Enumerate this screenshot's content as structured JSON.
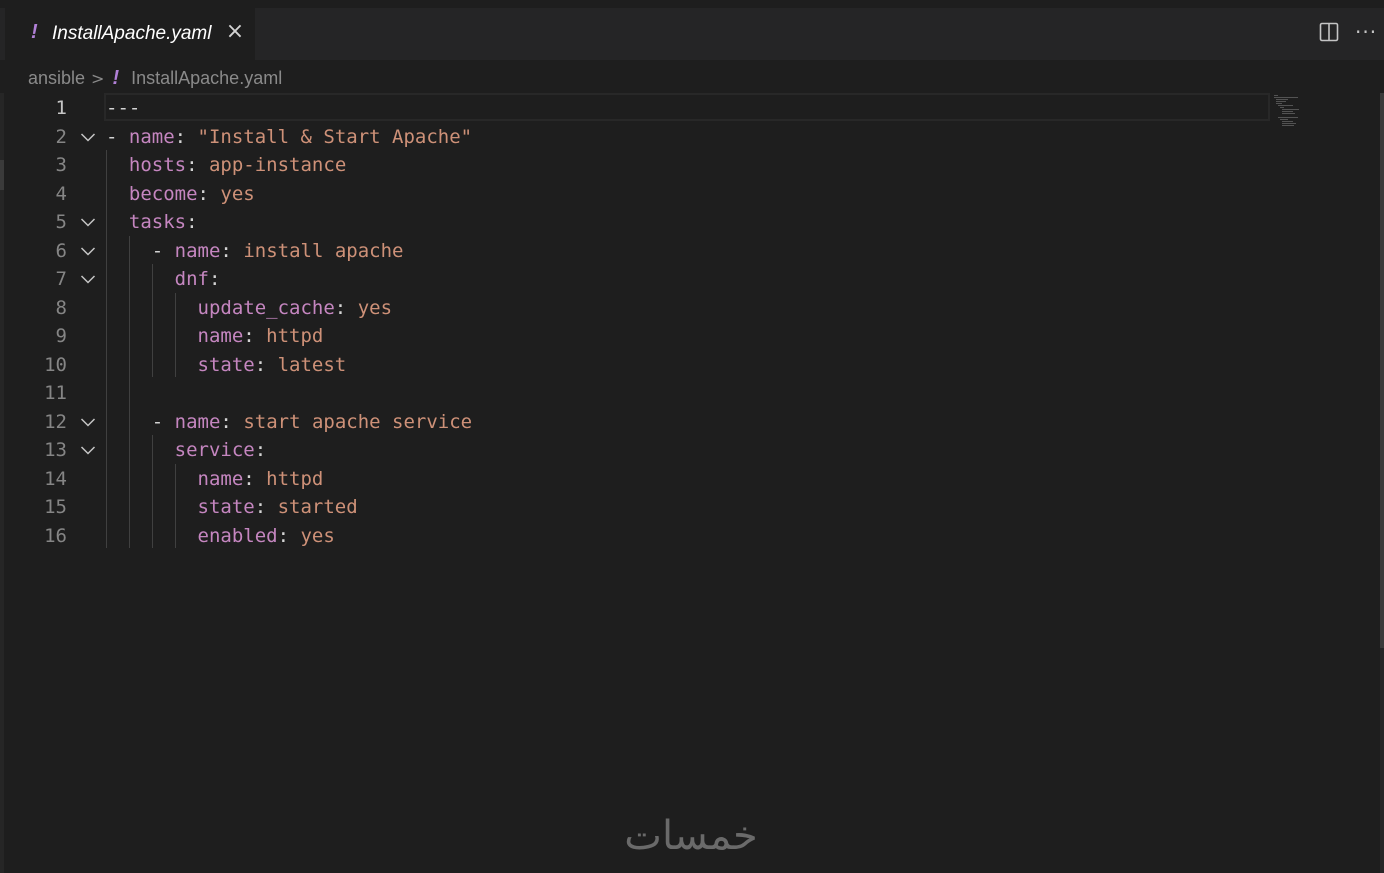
{
  "tab": {
    "icon": "!",
    "title": "InstallApache.yaml",
    "close_glyph": "×"
  },
  "toolbar": {
    "split_icon": "split-editor-icon",
    "more_icon": "more-actions-icon",
    "more_glyph": "···"
  },
  "breadcrumb": {
    "folder": "ansible",
    "separator": ">",
    "file_icon": "!",
    "file": "InstallApache.yaml"
  },
  "editor": {
    "language": "yaml",
    "active_line": 1,
    "colors": {
      "key": "#c586c0",
      "value": "#ce9178",
      "punctuation": "#d4d4d4",
      "line_number": "#858585",
      "background": "#1e1e1e"
    },
    "lines": [
      {
        "n": "1",
        "fold": false,
        "indent": "",
        "tokens": [
          {
            "t": "p",
            "s": "---"
          }
        ]
      },
      {
        "n": "2",
        "fold": true,
        "indent": "",
        "tokens": [
          {
            "t": "p",
            "s": "- "
          },
          {
            "t": "k",
            "s": "name"
          },
          {
            "t": "p",
            "s": ": "
          },
          {
            "t": "v",
            "s": "\"Install & Start Apache\""
          }
        ]
      },
      {
        "n": "3",
        "fold": false,
        "indent": "  ",
        "tokens": [
          {
            "t": "k",
            "s": "hosts"
          },
          {
            "t": "p",
            "s": ": "
          },
          {
            "t": "v",
            "s": "app-instance"
          }
        ]
      },
      {
        "n": "4",
        "fold": false,
        "indent": "  ",
        "tokens": [
          {
            "t": "k",
            "s": "become"
          },
          {
            "t": "p",
            "s": ": "
          },
          {
            "t": "v",
            "s": "yes"
          }
        ]
      },
      {
        "n": "5",
        "fold": true,
        "indent": "  ",
        "tokens": [
          {
            "t": "k",
            "s": "tasks"
          },
          {
            "t": "p",
            "s": ":"
          }
        ]
      },
      {
        "n": "6",
        "fold": true,
        "indent": "    ",
        "tokens": [
          {
            "t": "p",
            "s": "- "
          },
          {
            "t": "k",
            "s": "name"
          },
          {
            "t": "p",
            "s": ": "
          },
          {
            "t": "v",
            "s": "install apache"
          }
        ]
      },
      {
        "n": "7",
        "fold": true,
        "indent": "      ",
        "tokens": [
          {
            "t": "k",
            "s": "dnf"
          },
          {
            "t": "p",
            "s": ":"
          }
        ]
      },
      {
        "n": "8",
        "fold": false,
        "indent": "        ",
        "tokens": [
          {
            "t": "k",
            "s": "update_cache"
          },
          {
            "t": "p",
            "s": ": "
          },
          {
            "t": "v",
            "s": "yes"
          }
        ]
      },
      {
        "n": "9",
        "fold": false,
        "indent": "        ",
        "tokens": [
          {
            "t": "k",
            "s": "name"
          },
          {
            "t": "p",
            "s": ": "
          },
          {
            "t": "v",
            "s": "httpd"
          }
        ]
      },
      {
        "n": "10",
        "fold": false,
        "indent": "        ",
        "tokens": [
          {
            "t": "k",
            "s": "state"
          },
          {
            "t": "p",
            "s": ": "
          },
          {
            "t": "v",
            "s": "latest"
          }
        ]
      },
      {
        "n": "11",
        "fold": false,
        "indent": "",
        "tokens": []
      },
      {
        "n": "12",
        "fold": true,
        "indent": "    ",
        "tokens": [
          {
            "t": "p",
            "s": "- "
          },
          {
            "t": "k",
            "s": "name"
          },
          {
            "t": "p",
            "s": ": "
          },
          {
            "t": "v",
            "s": "start apache service"
          }
        ]
      },
      {
        "n": "13",
        "fold": true,
        "indent": "      ",
        "tokens": [
          {
            "t": "k",
            "s": "service"
          },
          {
            "t": "p",
            "s": ":"
          }
        ]
      },
      {
        "n": "14",
        "fold": false,
        "indent": "        ",
        "tokens": [
          {
            "t": "k",
            "s": "name"
          },
          {
            "t": "p",
            "s": ": "
          },
          {
            "t": "v",
            "s": "httpd"
          }
        ]
      },
      {
        "n": "15",
        "fold": false,
        "indent": "        ",
        "tokens": [
          {
            "t": "k",
            "s": "state"
          },
          {
            "t": "p",
            "s": ": "
          },
          {
            "t": "v",
            "s": "started"
          }
        ]
      },
      {
        "n": "16",
        "fold": false,
        "indent": "        ",
        "tokens": [
          {
            "t": "k",
            "s": "enabled"
          },
          {
            "t": "p",
            "s": ": "
          },
          {
            "t": "v",
            "s": "yes"
          }
        ]
      }
    ]
  },
  "watermark": {
    "text": "خمسات"
  }
}
